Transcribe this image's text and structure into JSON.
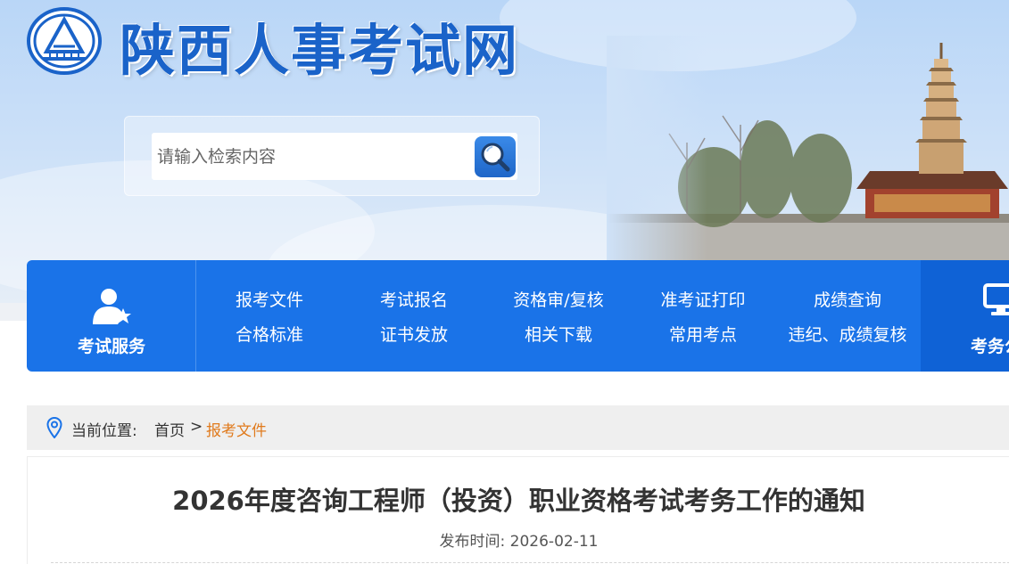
{
  "header": {
    "site_title": "陕西人事考试网"
  },
  "search": {
    "placeholder": "请输入检索内容"
  },
  "nav": {
    "service_label": "考试服务",
    "links_row1": [
      "报考文件",
      "考试报名",
      "资格审/复核",
      "准考证打印",
      "成绩查询"
    ],
    "links_row2": [
      "合格标准",
      "证书发放",
      "相关下载",
      "常用考点",
      "违纪、成绩复核"
    ],
    "right_label": "考务公"
  },
  "breadcrumb": {
    "prefix": "当前位置:",
    "home": "首页",
    "separator": ">",
    "current": "报考文件"
  },
  "article": {
    "title": "2026年度咨询工程师（投资）职业资格考试考务工作的通知",
    "publish_label": "发布时间:",
    "publish_date": "2026-02-11"
  },
  "colors": {
    "nav_bg": "#1a73e8",
    "title_blue": "#1a63c9",
    "breadcrumb_current": "#e07a1c"
  }
}
